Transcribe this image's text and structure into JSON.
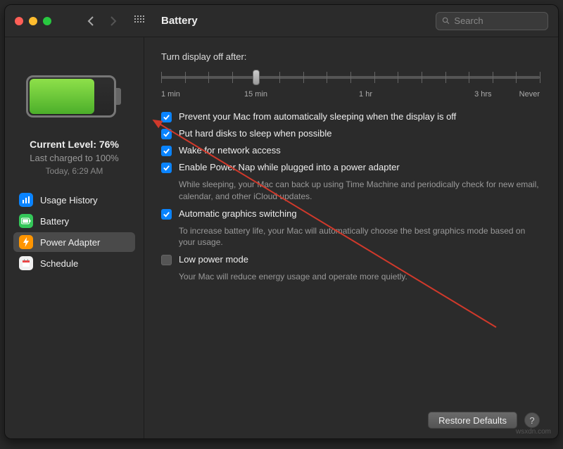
{
  "window": {
    "title": "Battery",
    "search_placeholder": "Search"
  },
  "sidebar": {
    "currentLevelLabel": "Current Level: 76%",
    "lastCharged": "Last charged to 100%",
    "timestamp": "Today, 6:29 AM",
    "items": [
      {
        "label": "Usage History",
        "iconColor": "blue",
        "icon": "chart-bar-icon"
      },
      {
        "label": "Battery",
        "iconColor": "green",
        "icon": "battery-icon"
      },
      {
        "label": "Power Adapter",
        "iconColor": "orange",
        "icon": "bolt-icon",
        "selected": true
      },
      {
        "label": "Schedule",
        "iconColor": "white",
        "icon": "calendar-icon"
      }
    ]
  },
  "main": {
    "sliderLabel": "Turn display off after:",
    "sliderTicks": [
      "1 min",
      "15 min",
      "1 hr",
      "3 hrs",
      "Never"
    ],
    "sliderValuePercent": 25,
    "options": [
      {
        "checked": true,
        "label": "Prevent your Mac from automatically sleeping when the display is off"
      },
      {
        "checked": true,
        "label": "Put hard disks to sleep when possible"
      },
      {
        "checked": true,
        "label": "Wake for network access"
      },
      {
        "checked": true,
        "label": "Enable Power Nap while plugged into a power adapter",
        "desc": "While sleeping, your Mac can back up using Time Machine and periodically check for new email, calendar, and other iCloud updates."
      },
      {
        "checked": true,
        "label": "Automatic graphics switching",
        "desc": "To increase battery life, your Mac will automatically choose the best graphics mode based on your usage."
      },
      {
        "checked": false,
        "label": "Low power mode",
        "desc": "Your Mac will reduce energy usage and operate more quietly."
      }
    ],
    "restoreButton": "Restore Defaults"
  },
  "watermark": "wsxdn.com"
}
